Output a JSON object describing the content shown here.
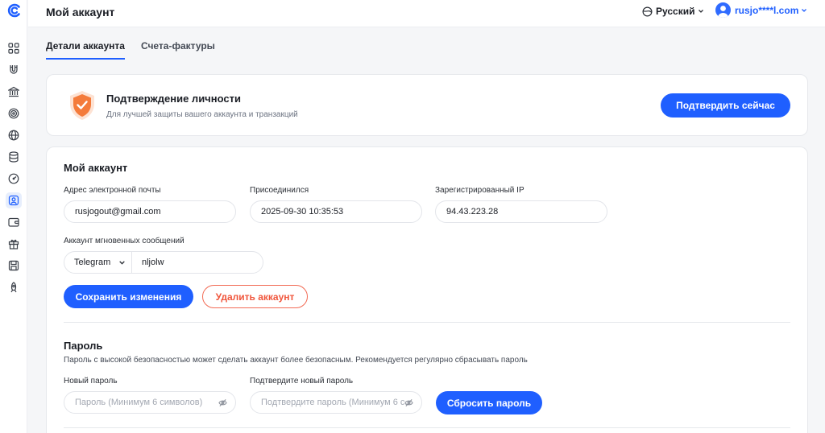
{
  "header": {
    "title": "Мой аккаунт",
    "language": "Русский",
    "user": "rusjo****l.com"
  },
  "sidebar": {
    "items": [
      {
        "icon": "grid-icon"
      },
      {
        "icon": "magnet-icon"
      },
      {
        "icon": "bank-icon"
      },
      {
        "icon": "target-icon"
      },
      {
        "icon": "globe-icon"
      },
      {
        "icon": "database-icon"
      },
      {
        "icon": "speedometer-icon"
      },
      {
        "icon": "user-card-icon",
        "active": true
      },
      {
        "icon": "wallet-icon"
      },
      {
        "icon": "gift-icon"
      },
      {
        "icon": "save-icon"
      },
      {
        "icon": "rocket-icon"
      }
    ]
  },
  "tabs": [
    {
      "label": "Детали аккаунта",
      "active": true
    },
    {
      "label": "Счета-фактуры",
      "active": false
    }
  ],
  "verify": {
    "title": "Подтверждение личности",
    "subtitle": "Для лучшей защиты вашего аккаунта и транзакций",
    "button": "Подтвердить сейчас"
  },
  "account": {
    "title": "Мой аккаунт",
    "email_label": "Адрес электронной почты",
    "email_value": "rusjogout@gmail.com",
    "joined_label": "Присоединился",
    "joined_value": "2025-09-30 10:35:53",
    "ip_label": "Зарегистрированный IP",
    "ip_value": "94.43.223.28",
    "im_label": "Аккаунт мгновенных сообщений",
    "im_type": "Telegram",
    "im_value": "nljolw",
    "save_button": "Сохранить изменения",
    "delete_button": "Удалить аккаунт"
  },
  "password": {
    "title": "Пароль",
    "description": "Пароль с высокой безопасностью может сделать аккаунт более безопасным. Рекомендуется регулярно сбрасывать пароль",
    "new_label": "Новый пароль",
    "new_placeholder": "Пароль (Минимум 6 символов)",
    "confirm_label": "Подтвердите новый пароль",
    "confirm_placeholder": "Подтвердите пароль (Минимум 6 с...",
    "reset_button": "Сбросить пароль"
  },
  "colors": {
    "accent": "#1f5fff",
    "danger": "#f0553b",
    "shield": "#f47b3b"
  }
}
